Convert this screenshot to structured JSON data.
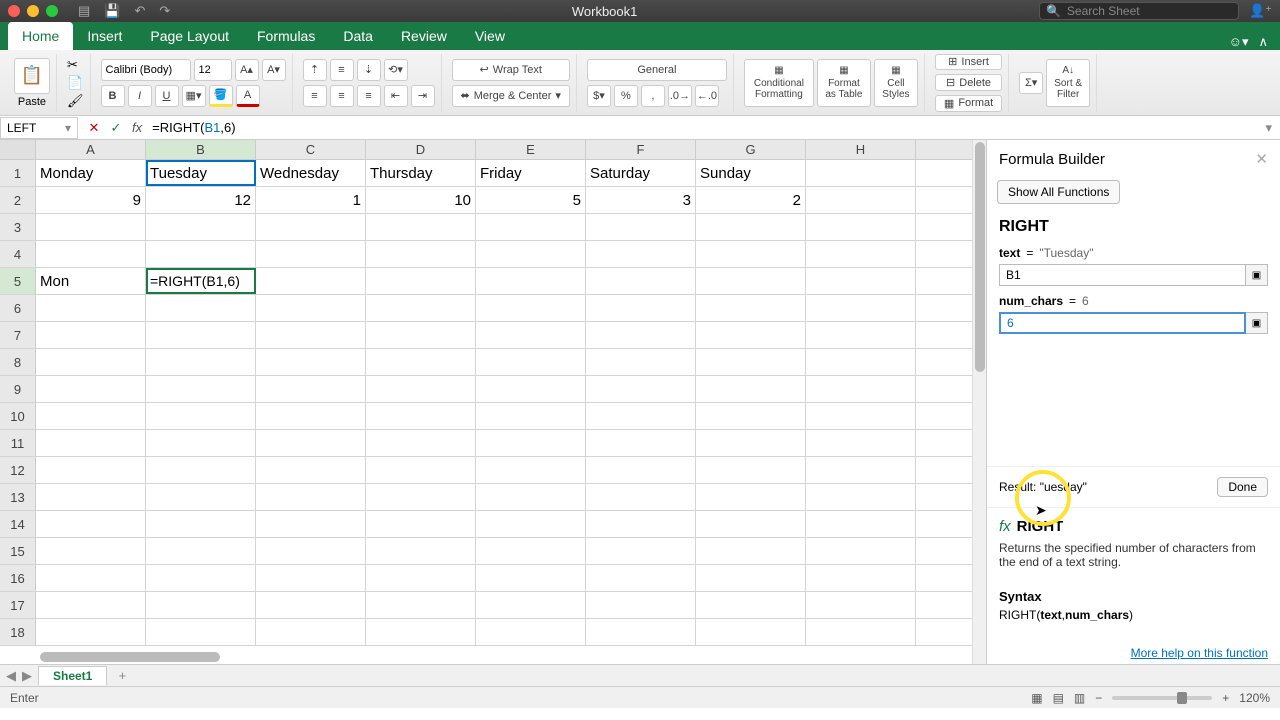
{
  "titlebar": {
    "title": "Workbook1",
    "search_placeholder": "Search Sheet"
  },
  "menu": {
    "tabs": [
      "Home",
      "Insert",
      "Page Layout",
      "Formulas",
      "Data",
      "Review",
      "View"
    ],
    "active": 0
  },
  "ribbon": {
    "paste_label": "Paste",
    "font_name": "Calibri (Body)",
    "font_size": "12",
    "wrap_text": "Wrap Text",
    "merge_center": "Merge & Center",
    "number_format": "General",
    "cond_fmt": "Conditional Formatting",
    "fmt_table": "Format as Table",
    "cell_styles": "Cell Styles",
    "insert": "Insert",
    "delete": "Delete",
    "format": "Format",
    "sort_filter": "Sort & Filter"
  },
  "formula_bar": {
    "name_box": "LEFT",
    "formula_display": "=RIGHT(B1,6)",
    "formula_prefix": "=RIGHT(",
    "formula_ref": "B1",
    "formula_suffix": ",6)"
  },
  "columns": [
    "A",
    "B",
    "C",
    "D",
    "E",
    "F",
    "G",
    "H"
  ],
  "active_col_index": 1,
  "active_row_index": 4,
  "cells": {
    "A1": "Monday",
    "B1": "Tuesday",
    "C1": "Wednesday",
    "D1": "Thursday",
    "E1": "Friday",
    "F1": "Saturday",
    "G1": "Sunday",
    "A2": "9",
    "B2": "12",
    "C2": "1",
    "D2": "10",
    "E2": "5",
    "F2": "3",
    "G2": "2",
    "A5": "Mon",
    "B5": "=RIGHT(B1,6)"
  },
  "formula_builder": {
    "title": "Formula Builder",
    "show_all": "Show All Functions",
    "fn_name": "RIGHT",
    "args": [
      {
        "name": "text",
        "equals": "=",
        "preview": "\"Tuesday\"",
        "value": "B1"
      },
      {
        "name": "num_chars",
        "equals": "=",
        "preview": "6",
        "value": "6"
      }
    ],
    "focus_arg": 1,
    "result_label": "Result:",
    "result_value": "\"uesday\"",
    "done": "Done",
    "desc": "Returns the specified number of characters from the end of a text string.",
    "syntax_title": "Syntax",
    "syntax": "RIGHT(text,num_chars)",
    "help": "More help on this function"
  },
  "sheet_tabs": {
    "active": "Sheet1"
  },
  "status": {
    "mode": "Enter",
    "zoom": "120%"
  },
  "chart_data": {
    "type": "table",
    "headers": [
      "Monday",
      "Tuesday",
      "Wednesday",
      "Thursday",
      "Friday",
      "Saturday",
      "Sunday"
    ],
    "values": [
      9,
      12,
      1,
      10,
      5,
      3,
      2
    ]
  }
}
